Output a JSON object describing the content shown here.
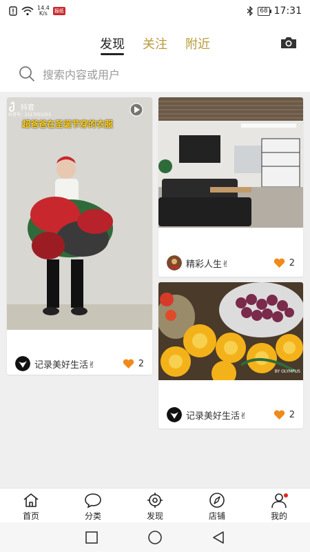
{
  "status_bar": {
    "net_speed_value": "14.4",
    "net_speed_unit": "K/s",
    "app_badge": "报纸",
    "battery": "68",
    "time": "17:31"
  },
  "top_tabs": [
    {
      "label": "发现",
      "active": true
    },
    {
      "label": "关注",
      "active": false
    },
    {
      "label": "附近",
      "active": false
    }
  ],
  "search": {
    "placeholder": "搜索内容或用户"
  },
  "cards": [
    {
      "overlay_brand": "抖音",
      "overlay_id": "抖音号：2117051055",
      "overlay_caption": "超爸爸在圣诞节穿的衣服",
      "author": "记录美好生活✌",
      "likes": "2"
    },
    {
      "author": "精彩人生✌",
      "likes": "2"
    },
    {
      "author": "记录美好生活✌",
      "likes": "2",
      "watermark": "BY OLYMPUS"
    }
  ],
  "bottom_nav": [
    {
      "label": "首页",
      "icon": "home-icon"
    },
    {
      "label": "分类",
      "icon": "chat-bubble-icon"
    },
    {
      "label": "发现",
      "icon": "target-icon"
    },
    {
      "label": "店铺",
      "icon": "compass-icon"
    },
    {
      "label": "我的",
      "icon": "person-icon"
    }
  ],
  "colors": {
    "accent_gold": "#b89a3a",
    "like_orange": "#f08a1a",
    "badge_red": "#e2231a"
  }
}
